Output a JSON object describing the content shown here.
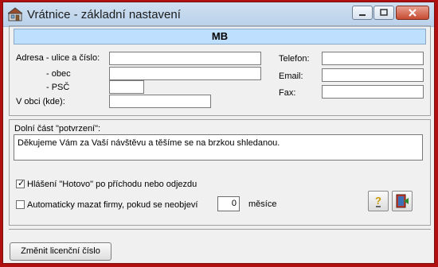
{
  "window": {
    "title": "Vrátnice - základní nastavení"
  },
  "header": {
    "heading": "MB"
  },
  "address": {
    "street_label": "Adresa - ulice a číslo:",
    "city_label": "- obec",
    "zip_label": "- PSČ",
    "in_village_label": "V obci (kde):",
    "street_value": "",
    "city_value": "",
    "zip_value": "",
    "in_village_value": ""
  },
  "contact": {
    "phone_label": "Telefon:",
    "email_label": "Email:",
    "fax_label": "Fax:",
    "phone_value": "",
    "email_value": "",
    "fax_value": ""
  },
  "confirmation": {
    "label": "Dolní část \"potvrzení\":",
    "text": "Děkujeme Vám za Vaší návštěvu a těšíme se na brzkou shledanou."
  },
  "options": {
    "report_done_label": "Hlášení \"Hotovo\" po příchodu nebo odjezdu",
    "report_done_checked": true,
    "auto_delete_label": "Automaticky mazat firmy, pokud se neobjeví",
    "auto_delete_checked": false,
    "months_value": "0",
    "months_label": "měsíce"
  },
  "icons": {
    "help": "help-icon",
    "exit": "exit-door-icon"
  },
  "footer": {
    "change_license_label": "Změnit licenční číslo"
  },
  "colors": {
    "heading_bg": "#bfdfff",
    "frame": "#b01010"
  }
}
